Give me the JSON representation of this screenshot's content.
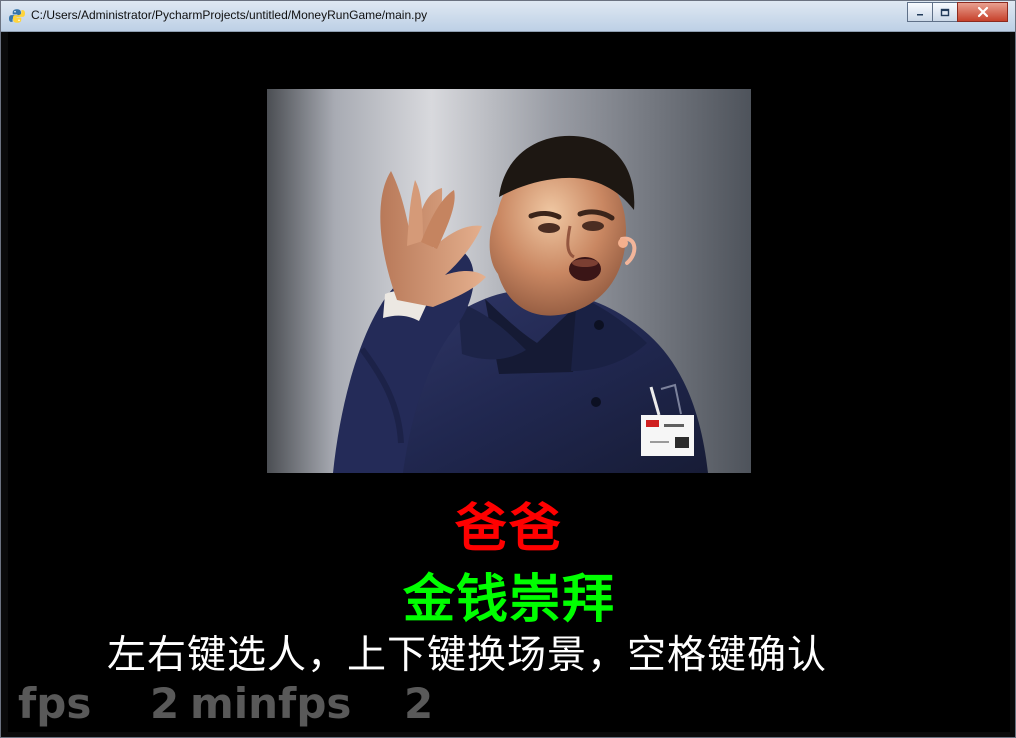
{
  "window": {
    "title": "C:/Users/Administrator/PycharmProjects/untitled/MoneyRunGame/main.py",
    "controls": {
      "minimize_icon": "minimize-icon",
      "maximize_icon": "maximize-icon",
      "close_icon": "close-icon"
    }
  },
  "game": {
    "name": "爸爸",
    "subtitle": "金钱崇拜",
    "instructions": "左右键选人，上下键换场景，空格键确认",
    "fps": {
      "label": "fps",
      "value": "2",
      "min_label": "minfps",
      "min_value": "2"
    }
  },
  "colors": {
    "background": "#000000",
    "title_red": "#ff0000",
    "subtitle_green": "#00ff00",
    "instructions_white": "#ffffff",
    "fps_gray": "#595959"
  }
}
